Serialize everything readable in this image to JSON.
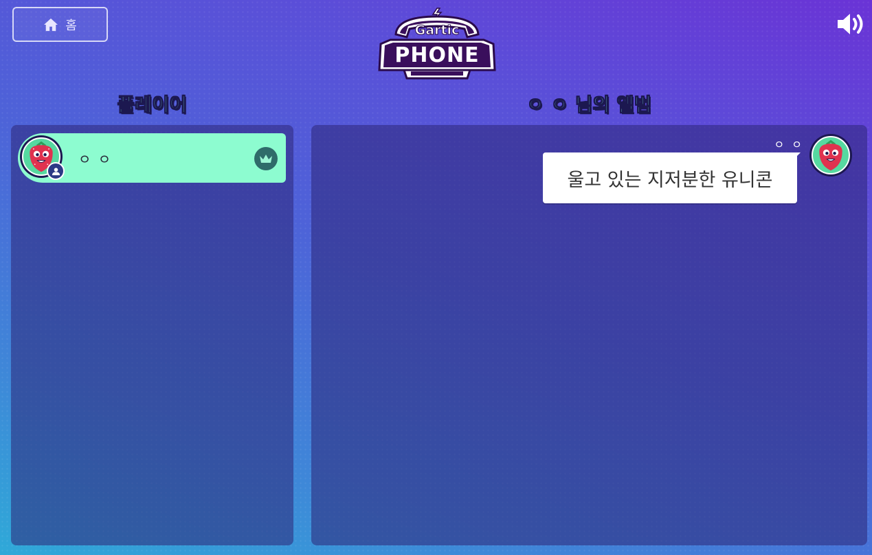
{
  "header": {
    "home_label": "홈",
    "logo_top_text": "Gartic",
    "logo_bottom_text": "PHONE"
  },
  "players_section": {
    "title": "플레이어",
    "players": [
      {
        "name": "ㅇ ㅇ",
        "is_host": true
      }
    ]
  },
  "album_section": {
    "title": "ㅇ ㅇ 님의 앨범",
    "entries": [
      {
        "author": "ㅇ ㅇ",
        "text": "울고 있는 지저분한 유니콘"
      }
    ]
  },
  "colors": {
    "accent_title": "#7ef0d4",
    "player_row_bg": "#8dfcd0",
    "panel_bg": "#2e2678"
  },
  "icons": [
    "home-icon",
    "volume-icon",
    "user-icon",
    "crown-icon",
    "strawberry-avatar"
  ]
}
